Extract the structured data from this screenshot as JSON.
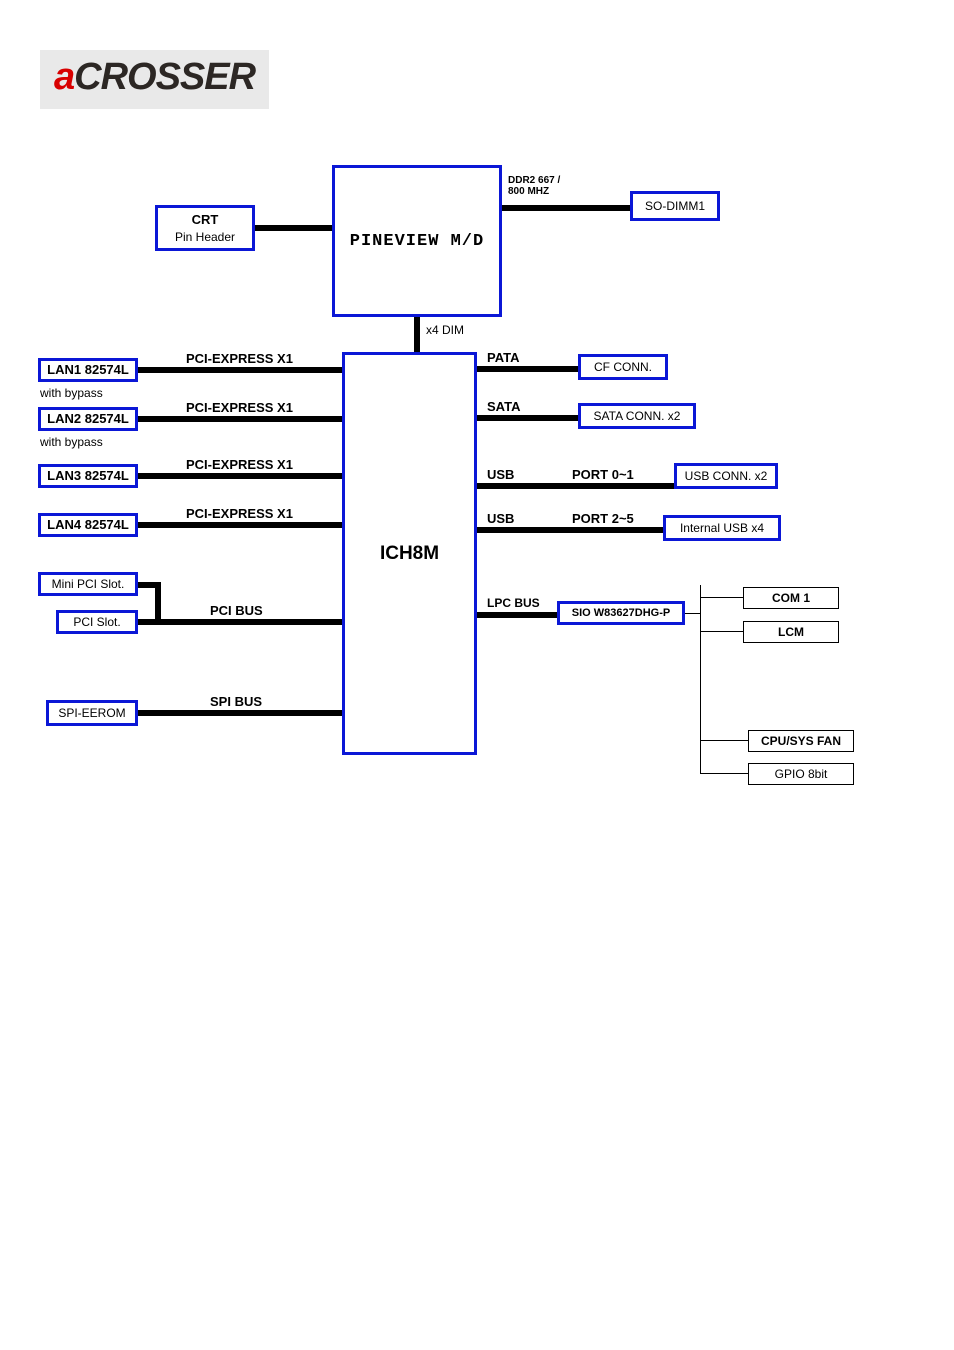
{
  "logo": {
    "prefix": "a",
    "rest": "CROSSER"
  },
  "blocks": {
    "pineview": "PINEVIEW M/D",
    "ich8m": "ICH8M",
    "crt_line1": "CRT",
    "crt_line2": "Pin Header",
    "sodimm": "SO-DIMM1",
    "ddr_line1": "DDR2  667 /",
    "ddr_line2": "800 MHZ",
    "dmi": "x4 DIM",
    "lan1": "LAN1 82574L",
    "lan1b": "with bypass",
    "lan2": "LAN2 82574L",
    "lan2b": "with bypass",
    "lan3": "LAN3 82574L",
    "lan4": "LAN4 82574L",
    "pcie": "PCI-EXPRESS X1",
    "mini_pci": "Mini PCI Slot.",
    "pci_slot": "PCI Slot.",
    "pci_bus": "PCI BUS",
    "spi_eerom": "SPI-EEROM",
    "spi_bus": "SPI BUS",
    "pata": "PATA",
    "cf_conn": "CF CONN.",
    "sata": "SATA",
    "sata_conn": "SATA CONN. x2",
    "usb": "USB",
    "port01": "PORT 0~1",
    "port25": "PORT 2~5",
    "usb_conn": "USB CONN. x2",
    "int_usb": "Internal USB x4",
    "lpc_bus": "LPC BUS",
    "sio": "SIO W83627DHG-P",
    "com1": "COM 1",
    "lcm": "LCM",
    "cpufan": "CPU/SYS FAN",
    "gpio": "GPIO 8bit"
  }
}
